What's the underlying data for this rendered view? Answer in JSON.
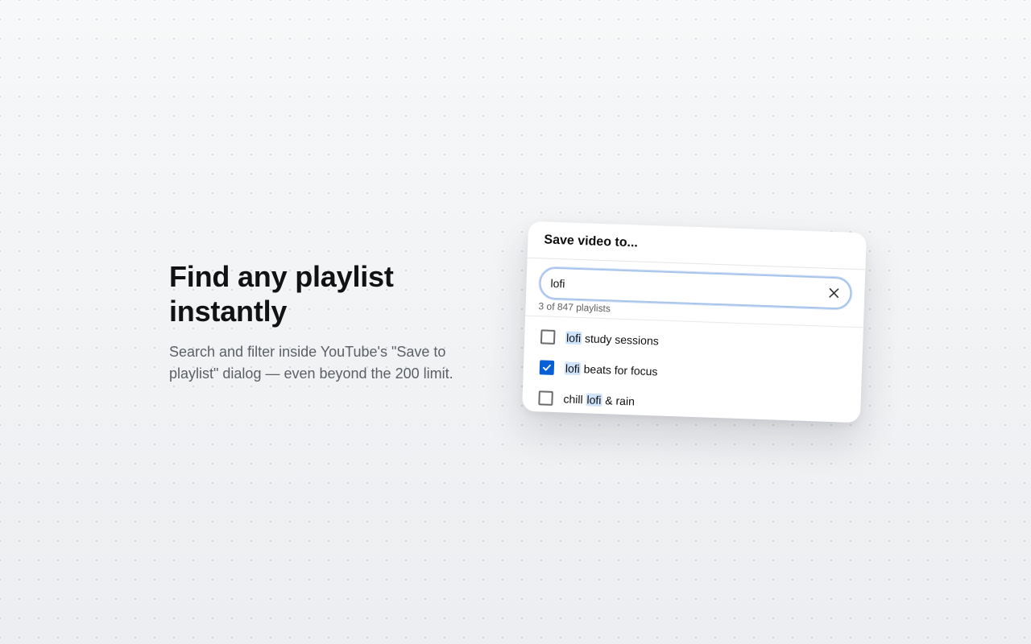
{
  "hero": {
    "title": "Find any playlist instantly",
    "subtitle": "Search and filter inside YouTube's \"Save to playlist\" dialog — even beyond the 200 limit."
  },
  "dialog": {
    "title": "Save video to...",
    "search": {
      "value": "lofi",
      "clear_icon": "close-icon"
    },
    "result_count": "3 of 847 playlists",
    "items": [
      {
        "before": "",
        "match": "lofi",
        "after": " study sessions",
        "checked": false
      },
      {
        "before": "",
        "match": "lofi",
        "after": " beats for focus",
        "checked": true
      },
      {
        "before": "chill ",
        "match": "lofi",
        "after": " & rain",
        "checked": false
      }
    ]
  },
  "colors": {
    "accent": "#065fd4",
    "highlight": "#cfe3fb",
    "focus_ring": "#a7c4ec"
  }
}
